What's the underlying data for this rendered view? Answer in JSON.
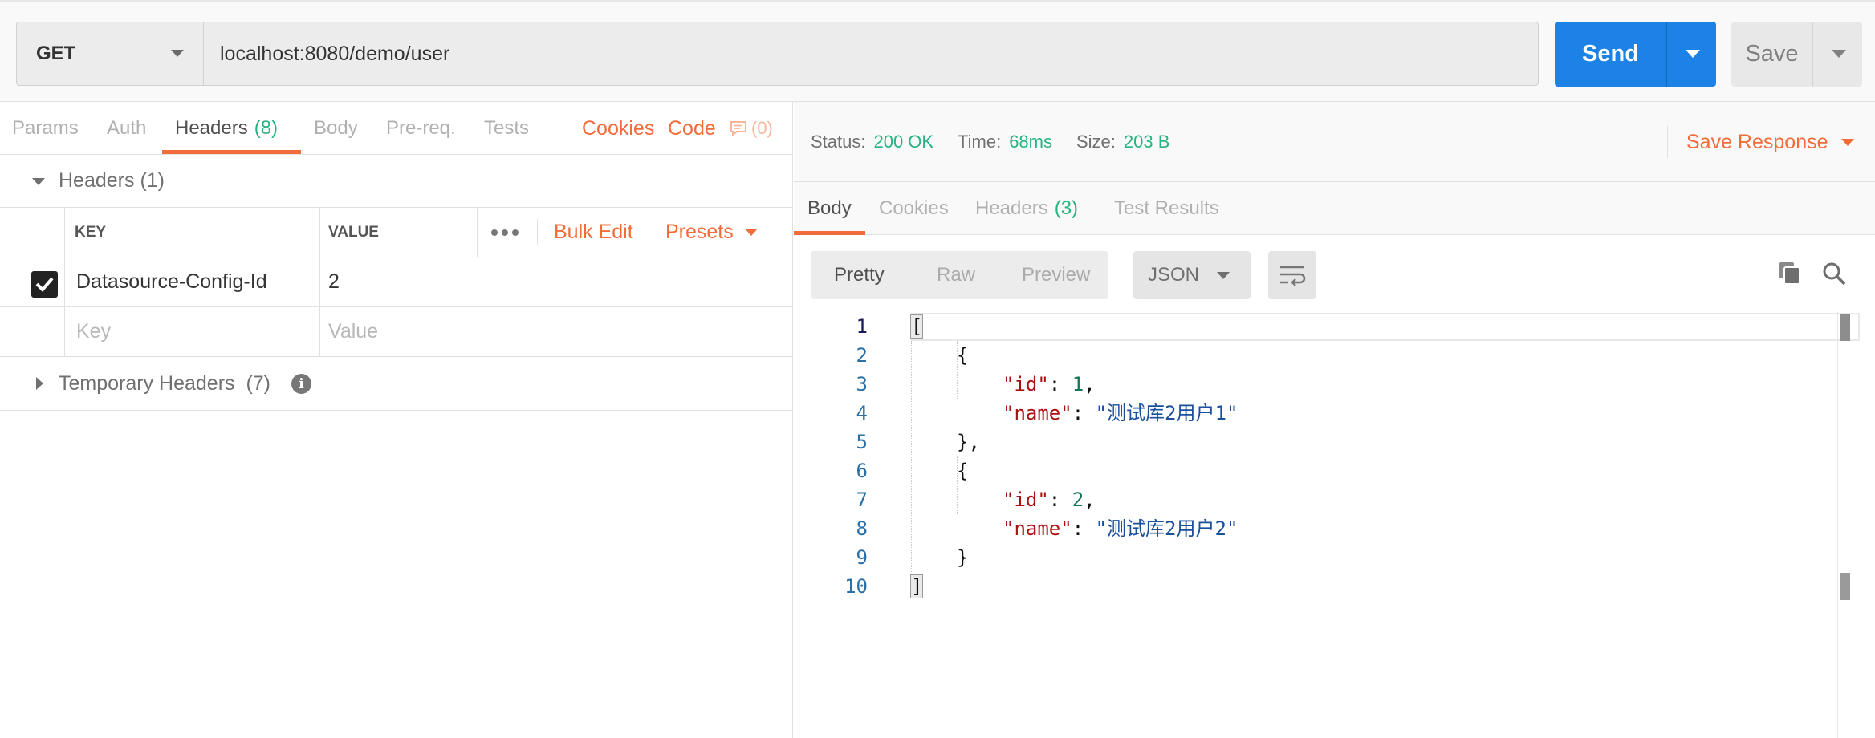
{
  "request": {
    "method": "GET",
    "url": "localhost:8080/demo/user",
    "send_label": "Send",
    "save_label": "Save"
  },
  "request_tabs": [
    {
      "label": "Params",
      "count": ""
    },
    {
      "label": "Auth",
      "count": ""
    },
    {
      "label": "Headers",
      "count": "(8)"
    },
    {
      "label": "Body",
      "count": ""
    },
    {
      "label": "Pre-req.",
      "count": ""
    },
    {
      "label": "Tests",
      "count": ""
    }
  ],
  "request_links": {
    "cookies": "Cookies",
    "code": "Code",
    "comments": "(0)"
  },
  "headers_section": {
    "title": "Headers",
    "count": "(1)",
    "col_key": "KEY",
    "col_value": "VALUE",
    "bulk_edit": "Bulk Edit",
    "presets": "Presets",
    "rows": [
      {
        "checked": true,
        "key": "Datasource-Config-Id",
        "value": "2"
      }
    ],
    "key_placeholder": "Key",
    "value_placeholder": "Value"
  },
  "temporary_headers": {
    "title": "Temporary Headers",
    "count": "(7)",
    "info_icon": "i"
  },
  "response": {
    "status_label": "Status:",
    "status_value": "200 OK",
    "time_label": "Time:",
    "time_value": "68ms",
    "size_label": "Size:",
    "size_value": "203 B",
    "save_response": "Save Response",
    "tabs": [
      {
        "label": "Body",
        "count": ""
      },
      {
        "label": "Cookies",
        "count": ""
      },
      {
        "label": "Headers",
        "count": "(3)"
      },
      {
        "label": "Test Results",
        "count": ""
      }
    ],
    "view_modes": [
      "Pretty",
      "Raw",
      "Preview"
    ],
    "active_view": "Pretty",
    "format": "JSON"
  },
  "body_lines": [
    {
      "n": "1",
      "text": "["
    },
    {
      "n": "2",
      "text": "{"
    },
    {
      "n": "3",
      "key": "\"id\"",
      "num": "1"
    },
    {
      "n": "4",
      "key": "\"name\"",
      "str": "\"测试库2用户1\""
    },
    {
      "n": "5",
      "text": "},"
    },
    {
      "n": "6",
      "text": "{"
    },
    {
      "n": "7",
      "key": "\"id\"",
      "num": "2"
    },
    {
      "n": "8",
      "key": "\"name\"",
      "str": "\"测试库2用户2\""
    },
    {
      "n": "9",
      "text": "}"
    },
    {
      "n": "10",
      "text": "]"
    }
  ],
  "colors": {
    "accent_orange": "#f26b3a",
    "send_blue": "#1d82e6",
    "status_green": "#26b47f"
  },
  "icons": [
    "caret-down-icon",
    "checkbox-checked-icon",
    "more-dots-icon",
    "info-icon",
    "comment-icon",
    "wrap-lines-icon",
    "copy-icon",
    "search-icon"
  ]
}
